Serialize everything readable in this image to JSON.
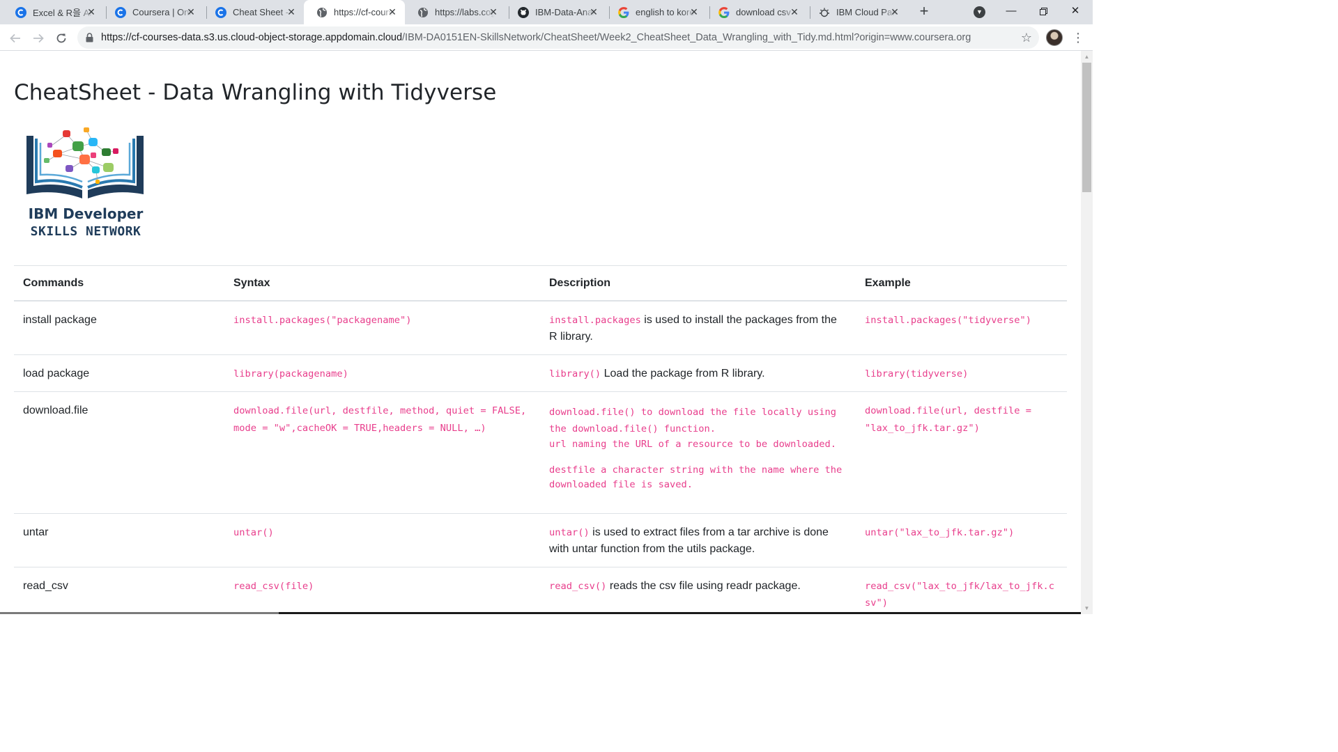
{
  "browser": {
    "tabs": [
      {
        "title": "Excel & R을 Analysis",
        "icon": "coursera-icon"
      },
      {
        "title": "Coursera | Online",
        "icon": "coursera-icon"
      },
      {
        "title": "Cheat Sheet - Data",
        "icon": "coursera-icon"
      },
      {
        "title": "https://cf-courses",
        "icon": "globe-icon"
      },
      {
        "title": "https://labs.cognitiveclass",
        "icon": "globe-icon"
      },
      {
        "title": "IBM-Data-Analyst",
        "icon": "github-icon"
      },
      {
        "title": "english to korean",
        "icon": "google-icon"
      },
      {
        "title": "download csv",
        "icon": "google-icon"
      },
      {
        "title": "IBM Cloud Pak",
        "icon": "ibm-cloud-icon"
      }
    ],
    "active_tab_index": 3,
    "url": {
      "host": "https://cf-courses-data.s3.us.cloud-object-storage.appdomain.cloud",
      "path": "/IBM-DA0151EN-SkillsNetwork/CheatSheet/Week2_CheatSheet_Data_Wrangling_with_Tidy.md.html?origin=www.coursera.org"
    }
  },
  "page": {
    "title": "CheatSheet - Data Wrangling with Tidyverse",
    "logo": {
      "line1": "IBM Developer",
      "line2": "SKILLS NETWORK"
    },
    "table": {
      "headers": [
        "Commands",
        "Syntax",
        "Description",
        "Example"
      ],
      "rows": [
        {
          "command": "install package",
          "syntax": "install.packages(\"packagename\")",
          "description_code": "install.packages",
          "description_text": " is used to install the packages from the R library.",
          "example": "install.packages(\"tidyverse\")"
        },
        {
          "command": "load package",
          "syntax": "library(packagename)",
          "description_code": "library()",
          "description_text": " Load the package from R library.",
          "example": "library(tidyverse)"
        },
        {
          "command": "download.file",
          "syntax": "download.file(url, destfile, method, quiet = FALSE, mode = \"w\",cacheOK = TRUE,headers = NULL, …)",
          "description_lines": [
            "download.file() to download the file locally using the download.file() function.",
            "url naming the URL of a resource to be downloaded.",
            "destfile a character string with the name where the downloaded file is saved."
          ],
          "example": "download.file(url, destfile = \"lax_to_jfk.tar.gz\")"
        },
        {
          "command": "untar",
          "syntax": "untar()",
          "description_code": "untar()",
          "description_text": " is used to extract files from a tar archive is done with untar function from the utils package.",
          "example": "untar(\"lax_to_jfk.tar.gz\")"
        },
        {
          "command": "read_csv",
          "syntax": "read_csv(file)",
          "description_code": "read_csv()",
          "description_text": " reads the csv file using readr package.",
          "example": "read_csv(\"lax_to_jfk/lax_to_jfk.csv\")"
        }
      ]
    }
  },
  "colors": {
    "code": "#e83e8c",
    "tabstrip": "#dee1e6",
    "logo_navy": "#1f3c5a"
  }
}
